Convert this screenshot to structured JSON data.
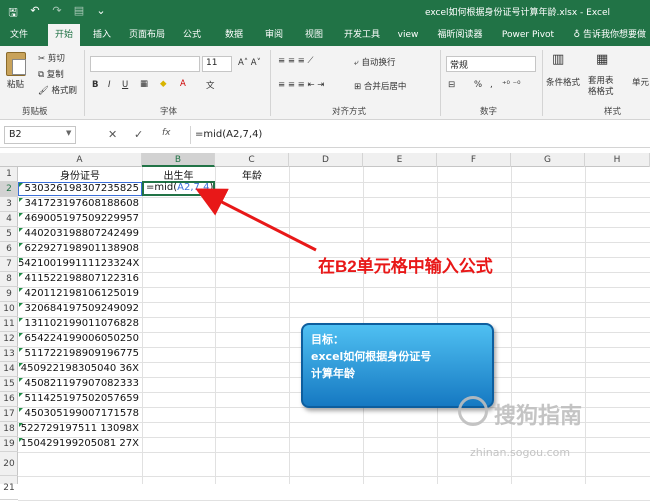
{
  "window": {
    "title": "excel如何根据身份证号计算年龄.xlsx - Excel",
    "qat": [
      "save-icon",
      "undo-icon",
      "redo-icon",
      "print-preview-icon",
      "customize-icon"
    ]
  },
  "tabs": [
    {
      "label": "文件"
    },
    {
      "label": "开始"
    },
    {
      "label": "插入"
    },
    {
      "label": "页面布局"
    },
    {
      "label": "公式"
    },
    {
      "label": "数据"
    },
    {
      "label": "审阅"
    },
    {
      "label": "视图"
    },
    {
      "label": "开发工具"
    },
    {
      "label": "view"
    },
    {
      "label": "福昕阅读器"
    },
    {
      "label": "Power Pivot"
    }
  ],
  "tell_me": "告诉我你想要做",
  "ribbon": {
    "clipboard": {
      "paste": "粘贴",
      "cut": "剪切",
      "copy": "复制",
      "format_painter": "格式刷",
      "label": "剪贴板"
    },
    "font": {
      "size": "11",
      "bold": "B",
      "italic": "I",
      "underline": "U",
      "label": "字体"
    },
    "alignment": {
      "wrap": "自动换行",
      "merge": "合并后居中",
      "label": "对齐方式"
    },
    "number": {
      "format": "常规",
      "percent": "%",
      "comma": ",",
      "label": "数字"
    },
    "styles": {
      "conditional": "条件格式",
      "table": "套用表格格式",
      "cell_styles": "单元",
      "label": "样式"
    }
  },
  "formula_bar": {
    "name_box": "B2",
    "formula": "=mid(A2,7,4)",
    "cancel": "✕",
    "enter": "✓",
    "fx": "fx"
  },
  "columns": [
    "A",
    "B",
    "C",
    "D",
    "E",
    "F",
    "G",
    "H"
  ],
  "rows": [
    "1",
    "2",
    "3",
    "4",
    "5",
    "6",
    "7",
    "8",
    "9",
    "10",
    "11",
    "12",
    "13",
    "14",
    "15",
    "16",
    "17",
    "18",
    "19",
    "20",
    "21"
  ],
  "sheet": {
    "headers": {
      "a1": "身份证号",
      "b1": "出生年",
      "c1": "年龄"
    },
    "b2_formula": "=mid(",
    "b2_ref": "A2,7,4",
    "b2_close": ")",
    "ids": [
      "530326198307235825",
      "341723197608188608",
      "469005197509229957",
      "440203198807242499",
      "622927198901138908",
      "542100199111123324X",
      "411522198807122316",
      "420112198106125019",
      "320684197509249092",
      "131102199011076828",
      "654224199006050250",
      "511722198909196775",
      "450922198305040 36X",
      "450821197907082333",
      "511425197502057659",
      "450305199007171578",
      "522729197511 13098X",
      "150429199205081 27X"
    ]
  },
  "annotation": "在B2单元格中输入公式",
  "goal_box": {
    "line1": "目标：",
    "line2": "excel如何根据身份证号",
    "line3": "计算年龄"
  },
  "watermark": {
    "text": "搜狗指南",
    "url": "zhinan.sogou.com"
  },
  "colors": {
    "excel_green": "#217346",
    "annotation_red": "#e81818",
    "reference_blue": "#3b6fd9"
  }
}
